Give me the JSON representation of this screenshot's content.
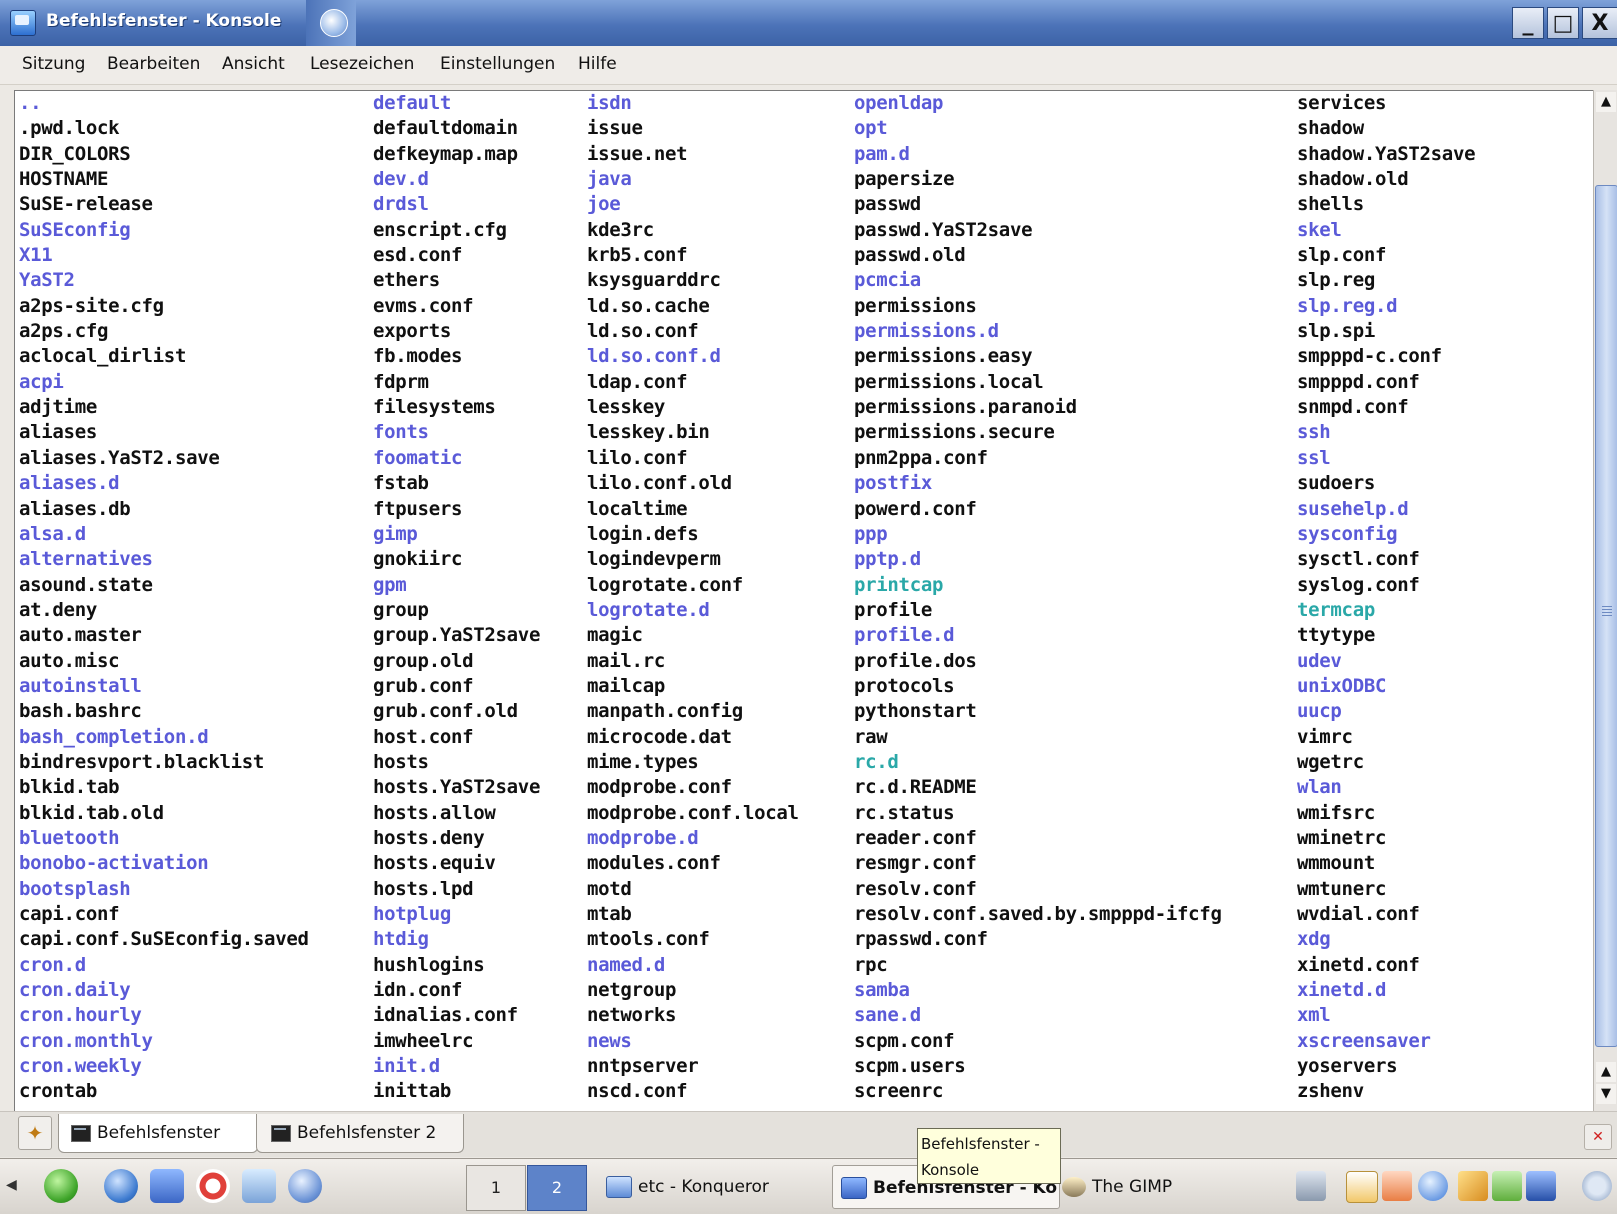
{
  "window": {
    "title": "Befehlsfenster - Konsole",
    "buttons": {
      "minimize": "_",
      "maximize": "□",
      "close": "X"
    }
  },
  "menu": [
    "Sitzung",
    "Bearbeiten",
    "Ansicht",
    "Lesezeichen",
    "Einstellungen",
    "Hilfe"
  ],
  "terminal": {
    "columns": [
      [
        {
          "name": "..",
          "type": "dir"
        },
        {
          "name": ".pwd.lock",
          "type": "file"
        },
        {
          "name": "DIR_COLORS",
          "type": "file"
        },
        {
          "name": "HOSTNAME",
          "type": "file"
        },
        {
          "name": "SuSE-release",
          "type": "file"
        },
        {
          "name": "SuSEconfig",
          "type": "dir"
        },
        {
          "name": "X11",
          "type": "dir"
        },
        {
          "name": "YaST2",
          "type": "dir"
        },
        {
          "name": "a2ps-site.cfg",
          "type": "file"
        },
        {
          "name": "a2ps.cfg",
          "type": "file"
        },
        {
          "name": "aclocal_dirlist",
          "type": "file"
        },
        {
          "name": "acpi",
          "type": "dir"
        },
        {
          "name": "adjtime",
          "type": "file"
        },
        {
          "name": "aliases",
          "type": "file"
        },
        {
          "name": "aliases.YaST2.save",
          "type": "file"
        },
        {
          "name": "aliases.d",
          "type": "dir"
        },
        {
          "name": "aliases.db",
          "type": "file"
        },
        {
          "name": "alsa.d",
          "type": "dir"
        },
        {
          "name": "alternatives",
          "type": "dir"
        },
        {
          "name": "asound.state",
          "type": "file"
        },
        {
          "name": "at.deny",
          "type": "file"
        },
        {
          "name": "auto.master",
          "type": "file"
        },
        {
          "name": "auto.misc",
          "type": "file"
        },
        {
          "name": "autoinstall",
          "type": "dir"
        },
        {
          "name": "bash.bashrc",
          "type": "file"
        },
        {
          "name": "bash_completion.d",
          "type": "dir"
        },
        {
          "name": "bindresvport.blacklist",
          "type": "file"
        },
        {
          "name": "blkid.tab",
          "type": "file"
        },
        {
          "name": "blkid.tab.old",
          "type": "file"
        },
        {
          "name": "bluetooth",
          "type": "dir"
        },
        {
          "name": "bonobo-activation",
          "type": "dir"
        },
        {
          "name": "bootsplash",
          "type": "dir"
        },
        {
          "name": "capi.conf",
          "type": "file"
        },
        {
          "name": "capi.conf.SuSEconfig.saved",
          "type": "file"
        },
        {
          "name": "cron.d",
          "type": "dir"
        },
        {
          "name": "cron.daily",
          "type": "dir"
        },
        {
          "name": "cron.hourly",
          "type": "dir"
        },
        {
          "name": "cron.monthly",
          "type": "dir"
        },
        {
          "name": "cron.weekly",
          "type": "dir"
        },
        {
          "name": "crontab",
          "type": "file"
        }
      ],
      [
        {
          "name": "default",
          "type": "dir"
        },
        {
          "name": "defaultdomain",
          "type": "file"
        },
        {
          "name": "defkeymap.map",
          "type": "file"
        },
        {
          "name": "dev.d",
          "type": "dir"
        },
        {
          "name": "drdsl",
          "type": "dir"
        },
        {
          "name": "enscript.cfg",
          "type": "file"
        },
        {
          "name": "esd.conf",
          "type": "file"
        },
        {
          "name": "ethers",
          "type": "file"
        },
        {
          "name": "evms.conf",
          "type": "file"
        },
        {
          "name": "exports",
          "type": "file"
        },
        {
          "name": "fb.modes",
          "type": "file"
        },
        {
          "name": "fdprm",
          "type": "file"
        },
        {
          "name": "filesystems",
          "type": "file"
        },
        {
          "name": "fonts",
          "type": "dir"
        },
        {
          "name": "foomatic",
          "type": "dir"
        },
        {
          "name": "fstab",
          "type": "file"
        },
        {
          "name": "ftpusers",
          "type": "file"
        },
        {
          "name": "gimp",
          "type": "dir"
        },
        {
          "name": "gnokiirc",
          "type": "file"
        },
        {
          "name": "gpm",
          "type": "dir"
        },
        {
          "name": "group",
          "type": "file"
        },
        {
          "name": "group.YaST2save",
          "type": "file"
        },
        {
          "name": "group.old",
          "type": "file"
        },
        {
          "name": "grub.conf",
          "type": "file"
        },
        {
          "name": "grub.conf.old",
          "type": "file"
        },
        {
          "name": "host.conf",
          "type": "file"
        },
        {
          "name": "hosts",
          "type": "file"
        },
        {
          "name": "hosts.YaST2save",
          "type": "file"
        },
        {
          "name": "hosts.allow",
          "type": "file"
        },
        {
          "name": "hosts.deny",
          "type": "file"
        },
        {
          "name": "hosts.equiv",
          "type": "file"
        },
        {
          "name": "hosts.lpd",
          "type": "file"
        },
        {
          "name": "hotplug",
          "type": "dir"
        },
        {
          "name": "htdig",
          "type": "dir"
        },
        {
          "name": "hushlogins",
          "type": "file"
        },
        {
          "name": "idn.conf",
          "type": "file"
        },
        {
          "name": "idnalias.conf",
          "type": "file"
        },
        {
          "name": "imwheelrc",
          "type": "file"
        },
        {
          "name": "init.d",
          "type": "dir"
        },
        {
          "name": "inittab",
          "type": "file"
        }
      ],
      [
        {
          "name": "isdn",
          "type": "dir"
        },
        {
          "name": "issue",
          "type": "file"
        },
        {
          "name": "issue.net",
          "type": "file"
        },
        {
          "name": "java",
          "type": "dir"
        },
        {
          "name": "joe",
          "type": "dir"
        },
        {
          "name": "kde3rc",
          "type": "file"
        },
        {
          "name": "krb5.conf",
          "type": "file"
        },
        {
          "name": "ksysguarddrc",
          "type": "file"
        },
        {
          "name": "ld.so.cache",
          "type": "file"
        },
        {
          "name": "ld.so.conf",
          "type": "file"
        },
        {
          "name": "ld.so.conf.d",
          "type": "dir"
        },
        {
          "name": "ldap.conf",
          "type": "file"
        },
        {
          "name": "lesskey",
          "type": "file"
        },
        {
          "name": "lesskey.bin",
          "type": "file"
        },
        {
          "name": "lilo.conf",
          "type": "file"
        },
        {
          "name": "lilo.conf.old",
          "type": "file"
        },
        {
          "name": "localtime",
          "type": "file"
        },
        {
          "name": "login.defs",
          "type": "file"
        },
        {
          "name": "logindevperm",
          "type": "file"
        },
        {
          "name": "logrotate.conf",
          "type": "file"
        },
        {
          "name": "logrotate.d",
          "type": "dir"
        },
        {
          "name": "magic",
          "type": "file"
        },
        {
          "name": "mail.rc",
          "type": "file"
        },
        {
          "name": "mailcap",
          "type": "file"
        },
        {
          "name": "manpath.config",
          "type": "file"
        },
        {
          "name": "microcode.dat",
          "type": "file"
        },
        {
          "name": "mime.types",
          "type": "file"
        },
        {
          "name": "modprobe.conf",
          "type": "file"
        },
        {
          "name": "modprobe.conf.local",
          "type": "file"
        },
        {
          "name": "modprobe.d",
          "type": "dir"
        },
        {
          "name": "modules.conf",
          "type": "file"
        },
        {
          "name": "motd",
          "type": "file"
        },
        {
          "name": "mtab",
          "type": "file"
        },
        {
          "name": "mtools.conf",
          "type": "file"
        },
        {
          "name": "named.d",
          "type": "dir"
        },
        {
          "name": "netgroup",
          "type": "file"
        },
        {
          "name": "networks",
          "type": "file"
        },
        {
          "name": "news",
          "type": "dir"
        },
        {
          "name": "nntpserver",
          "type": "file"
        },
        {
          "name": "nscd.conf",
          "type": "file"
        }
      ],
      [
        {
          "name": "openldap",
          "type": "dir"
        },
        {
          "name": "opt",
          "type": "dir"
        },
        {
          "name": "pam.d",
          "type": "dir"
        },
        {
          "name": "papersize",
          "type": "file"
        },
        {
          "name": "passwd",
          "type": "file"
        },
        {
          "name": "passwd.YaST2save",
          "type": "file"
        },
        {
          "name": "passwd.old",
          "type": "file"
        },
        {
          "name": "pcmcia",
          "type": "dir"
        },
        {
          "name": "permissions",
          "type": "file"
        },
        {
          "name": "permissions.d",
          "type": "dir"
        },
        {
          "name": "permissions.easy",
          "type": "file"
        },
        {
          "name": "permissions.local",
          "type": "file"
        },
        {
          "name": "permissions.paranoid",
          "type": "file"
        },
        {
          "name": "permissions.secure",
          "type": "file"
        },
        {
          "name": "pnm2ppa.conf",
          "type": "file"
        },
        {
          "name": "postfix",
          "type": "dir"
        },
        {
          "name": "powerd.conf",
          "type": "file"
        },
        {
          "name": "ppp",
          "type": "dir"
        },
        {
          "name": "pptp.d",
          "type": "dir"
        },
        {
          "name": "printcap",
          "type": "link"
        },
        {
          "name": "profile",
          "type": "file"
        },
        {
          "name": "profile.d",
          "type": "dir"
        },
        {
          "name": "profile.dos",
          "type": "file"
        },
        {
          "name": "protocols",
          "type": "file"
        },
        {
          "name": "pythonstart",
          "type": "file"
        },
        {
          "name": "raw",
          "type": "file"
        },
        {
          "name": "rc.d",
          "type": "link"
        },
        {
          "name": "rc.d.README",
          "type": "file"
        },
        {
          "name": "rc.status",
          "type": "file"
        },
        {
          "name": "reader.conf",
          "type": "file"
        },
        {
          "name": "resmgr.conf",
          "type": "file"
        },
        {
          "name": "resolv.conf",
          "type": "file"
        },
        {
          "name": "resolv.conf.saved.by.smpppd-ifcfg",
          "type": "file"
        },
        {
          "name": "rpasswd.conf",
          "type": "file"
        },
        {
          "name": "rpc",
          "type": "file"
        },
        {
          "name": "samba",
          "type": "dir"
        },
        {
          "name": "sane.d",
          "type": "dir"
        },
        {
          "name": "scpm.conf",
          "type": "file"
        },
        {
          "name": "scpm.users",
          "type": "file"
        },
        {
          "name": "screenrc",
          "type": "file"
        }
      ],
      [
        {
          "name": "services",
          "type": "file"
        },
        {
          "name": "shadow",
          "type": "file"
        },
        {
          "name": "shadow.YaST2save",
          "type": "file"
        },
        {
          "name": "shadow.old",
          "type": "file"
        },
        {
          "name": "shells",
          "type": "file"
        },
        {
          "name": "skel",
          "type": "dir"
        },
        {
          "name": "slp.conf",
          "type": "file"
        },
        {
          "name": "slp.reg",
          "type": "file"
        },
        {
          "name": "slp.reg.d",
          "type": "dir"
        },
        {
          "name": "slp.spi",
          "type": "file"
        },
        {
          "name": "smpppd-c.conf",
          "type": "file"
        },
        {
          "name": "smpppd.conf",
          "type": "file"
        },
        {
          "name": "snmpd.conf",
          "type": "file"
        },
        {
          "name": "ssh",
          "type": "dir"
        },
        {
          "name": "ssl",
          "type": "dir"
        },
        {
          "name": "sudoers",
          "type": "file"
        },
        {
          "name": "susehelp.d",
          "type": "dir"
        },
        {
          "name": "sysconfig",
          "type": "dir"
        },
        {
          "name": "sysctl.conf",
          "type": "file"
        },
        {
          "name": "syslog.conf",
          "type": "file"
        },
        {
          "name": "termcap",
          "type": "link"
        },
        {
          "name": "ttytype",
          "type": "file"
        },
        {
          "name": "udev",
          "type": "dir"
        },
        {
          "name": "unixODBC",
          "type": "dir"
        },
        {
          "name": "uucp",
          "type": "dir"
        },
        {
          "name": "vimrc",
          "type": "file"
        },
        {
          "name": "wgetrc",
          "type": "file"
        },
        {
          "name": "wlan",
          "type": "dir"
        },
        {
          "name": "wmifsrc",
          "type": "file"
        },
        {
          "name": "wminetrc",
          "type": "file"
        },
        {
          "name": "wmmount",
          "type": "file"
        },
        {
          "name": "wmtunerc",
          "type": "file"
        },
        {
          "name": "wvdial.conf",
          "type": "file"
        },
        {
          "name": "xdg",
          "type": "dir"
        },
        {
          "name": "xinetd.conf",
          "type": "file"
        },
        {
          "name": "xinetd.d",
          "type": "dir"
        },
        {
          "name": "xml",
          "type": "dir"
        },
        {
          "name": "xscreensaver",
          "type": "dir"
        },
        {
          "name": "yoservers",
          "type": "file"
        },
        {
          "name": "zshenv",
          "type": "file"
        }
      ]
    ],
    "colors": {
      "file": "#101010",
      "dir": "#5a5ad8",
      "link": "#2aa8a8"
    }
  },
  "tabs": [
    {
      "label": "Befehlsfenster",
      "active": true
    },
    {
      "label": "Befehlsfenster 2",
      "active": false
    }
  ],
  "tooltip": "Befehlsfenster - Konsole",
  "taskbar": {
    "pager": [
      "1",
      "2"
    ],
    "tasks": [
      {
        "label": "etc - Konqueror",
        "icon": "folder-icon"
      },
      {
        "label": "Befehlsfenster - Ko",
        "icon": "konsole-icon",
        "active": true
      },
      {
        "label": "The GIMP",
        "icon": "gimp-icon"
      }
    ]
  }
}
